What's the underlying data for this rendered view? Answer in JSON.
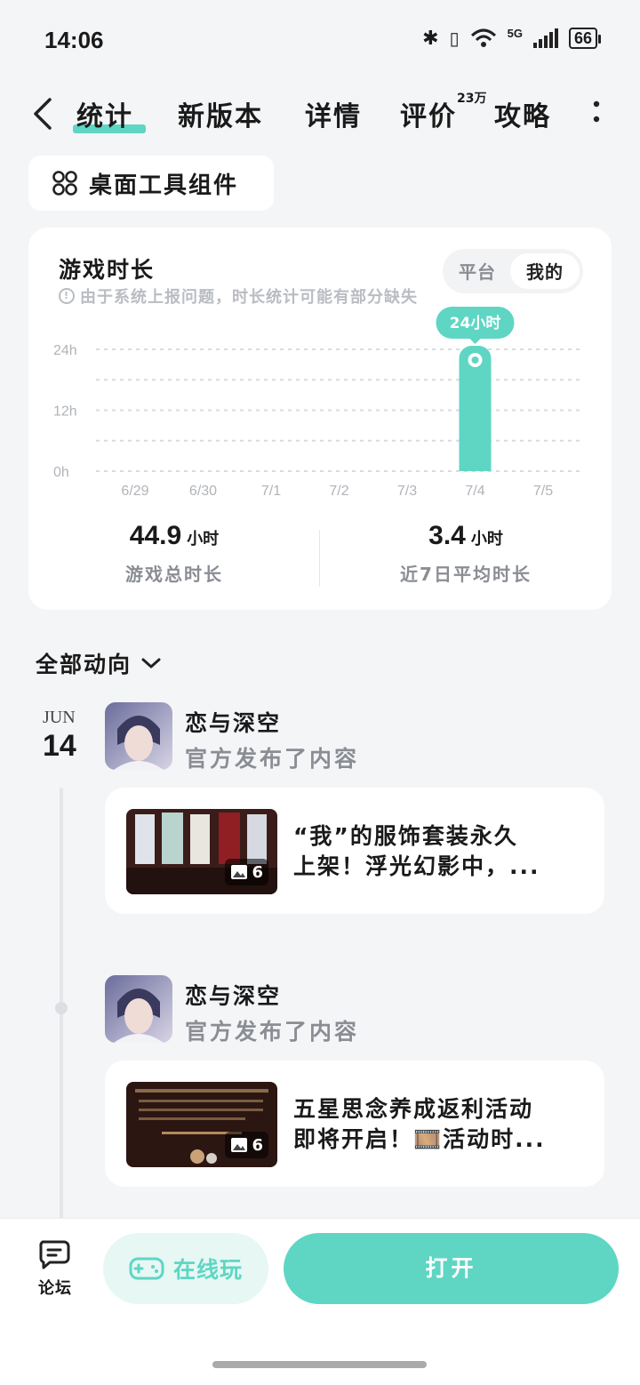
{
  "status_bar": {
    "time": "14:06",
    "network": "5G",
    "battery": "66"
  },
  "nav": {
    "tabs": [
      {
        "label": "统计",
        "active": true
      },
      {
        "label": "新版本"
      },
      {
        "label": "详情"
      },
      {
        "label": "评价",
        "badge": "23万"
      },
      {
        "label": "攻略"
      }
    ]
  },
  "widget_button": {
    "label": "桌面工具组件"
  },
  "stats_card": {
    "title": "游戏时长",
    "toggle": [
      "平台",
      "我的"
    ],
    "toggle_selected": "我的",
    "notice": "由于系统上报问题，时长统计可能有部分缺失",
    "summary": [
      {
        "value": "44.9",
        "unit": "小时",
        "caption": "游戏总时长"
      },
      {
        "value": "3.4",
        "unit": "小时",
        "caption": "近7日平均时长"
      }
    ]
  },
  "chart_data": {
    "type": "bar",
    "categories": [
      "6/29",
      "6/30",
      "7/1",
      "7/2",
      "7/3",
      "7/4",
      "7/5"
    ],
    "values": [
      0,
      0,
      0,
      0,
      0,
      24,
      0
    ],
    "y_ticks": [
      "24h",
      "12h",
      "0h"
    ],
    "ylim": [
      0,
      24
    ],
    "highlight_label": "24小时",
    "bar_color": "#5ed6c3",
    "grid": "dashed"
  },
  "feed": {
    "header": "全部动向",
    "date": {
      "month": "JUN",
      "day": "14"
    },
    "posts": [
      {
        "author": "恋与深空",
        "action": "官方发布了内容",
        "text_line1": "“我”的服饰套装永久",
        "text_line2": "上架！浮光幻影中，...",
        "image_count": "6"
      },
      {
        "author": "恋与深空",
        "action": "官方发布了内容",
        "text_line1": "五星思念养成返利活动",
        "text_line2": "即将开启！🎞️活动时...",
        "image_count": "6"
      }
    ]
  },
  "bottom_bar": {
    "forum_label": "论坛",
    "play_label": "在线玩",
    "open_label": "打开"
  },
  "colors": {
    "accent": "#5ed6c3",
    "accent_light": "#e6f7f4",
    "background": "#f4f5f7"
  }
}
